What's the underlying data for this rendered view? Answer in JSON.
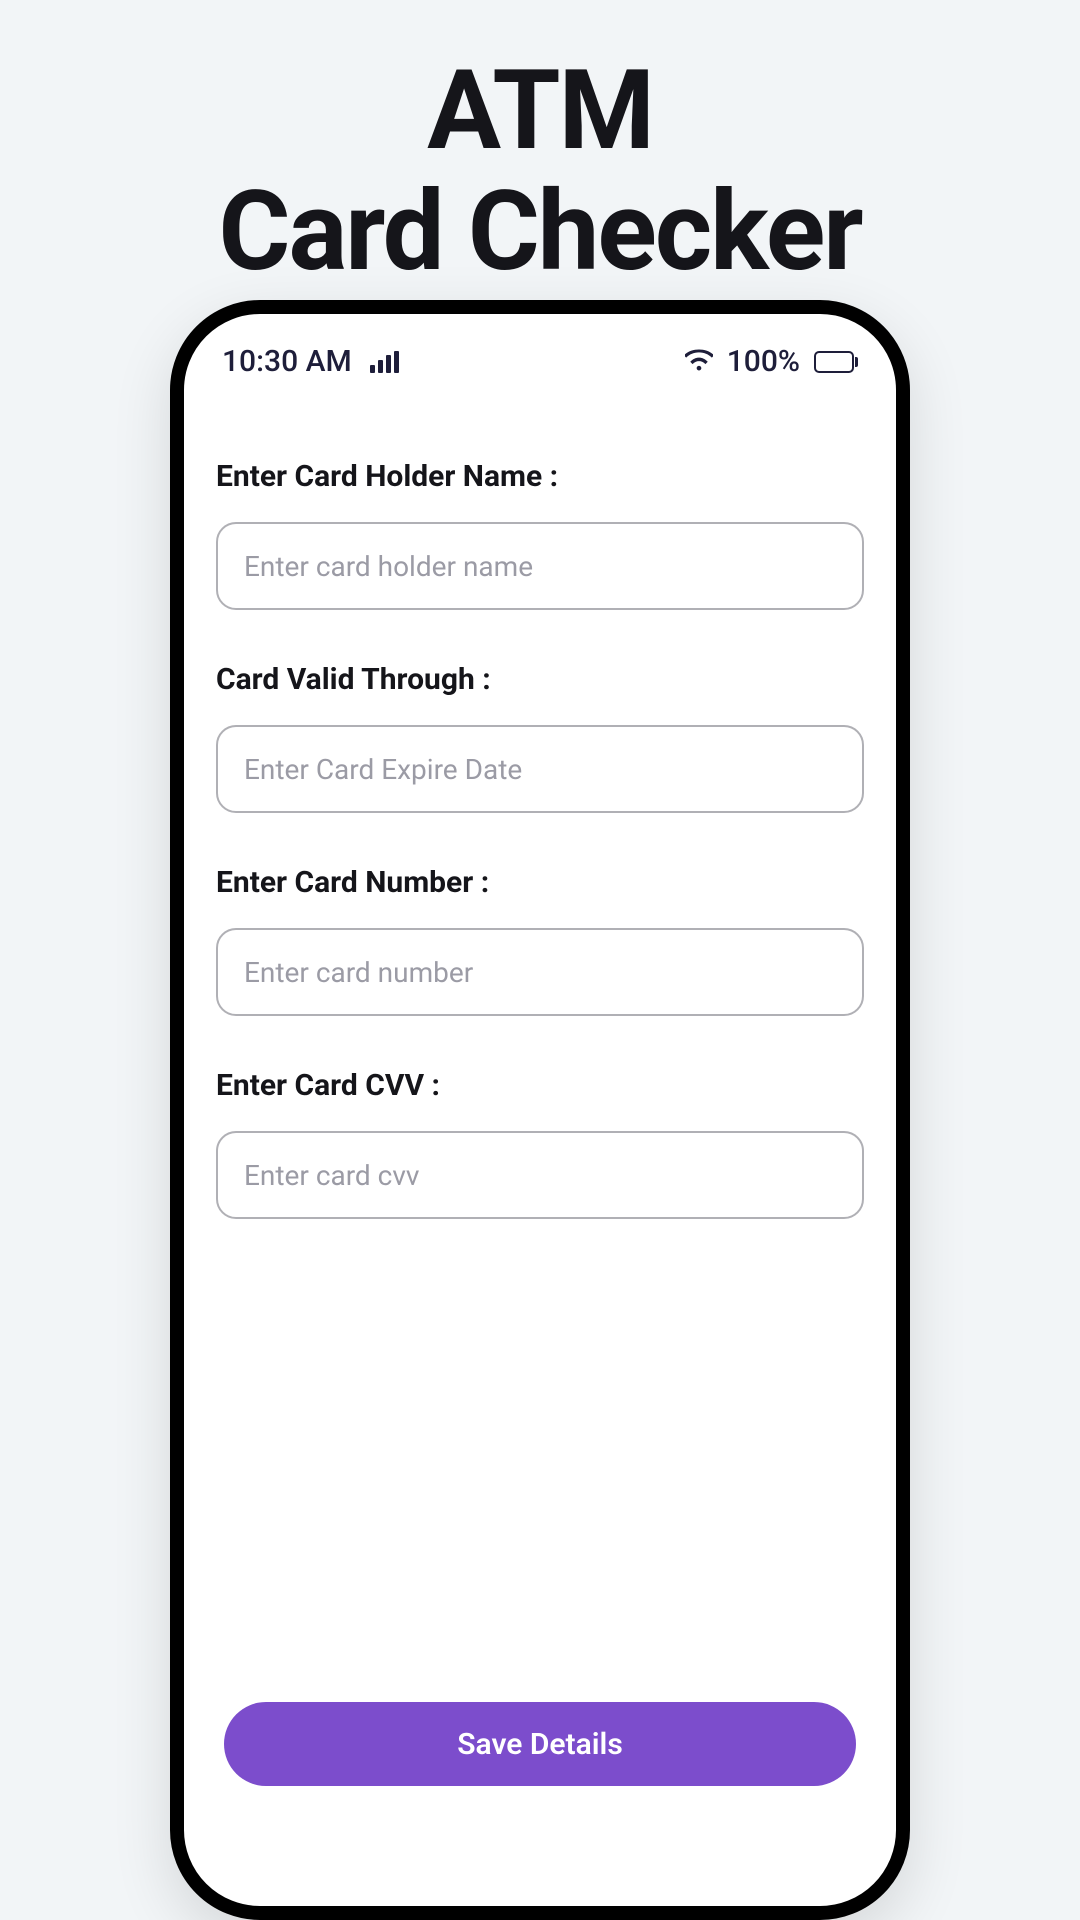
{
  "header": {
    "title_line1": "ATM",
    "title_line2": "Card Checker"
  },
  "statusBar": {
    "time": "10:30 AM",
    "batteryPercent": "100%"
  },
  "form": {
    "cardHolderName": {
      "label": "Enter Card Holder Name :",
      "placeholder": "Enter card holder name"
    },
    "validThrough": {
      "label": "Card Valid Through :",
      "placeholder": "Enter Card Expire Date"
    },
    "cardNumber": {
      "label": "Enter Card Number :",
      "placeholder": "Enter card number"
    },
    "cvv": {
      "label": "Enter Card CVV :",
      "placeholder": "Enter card cvv"
    },
    "saveButton": "Save Details"
  }
}
